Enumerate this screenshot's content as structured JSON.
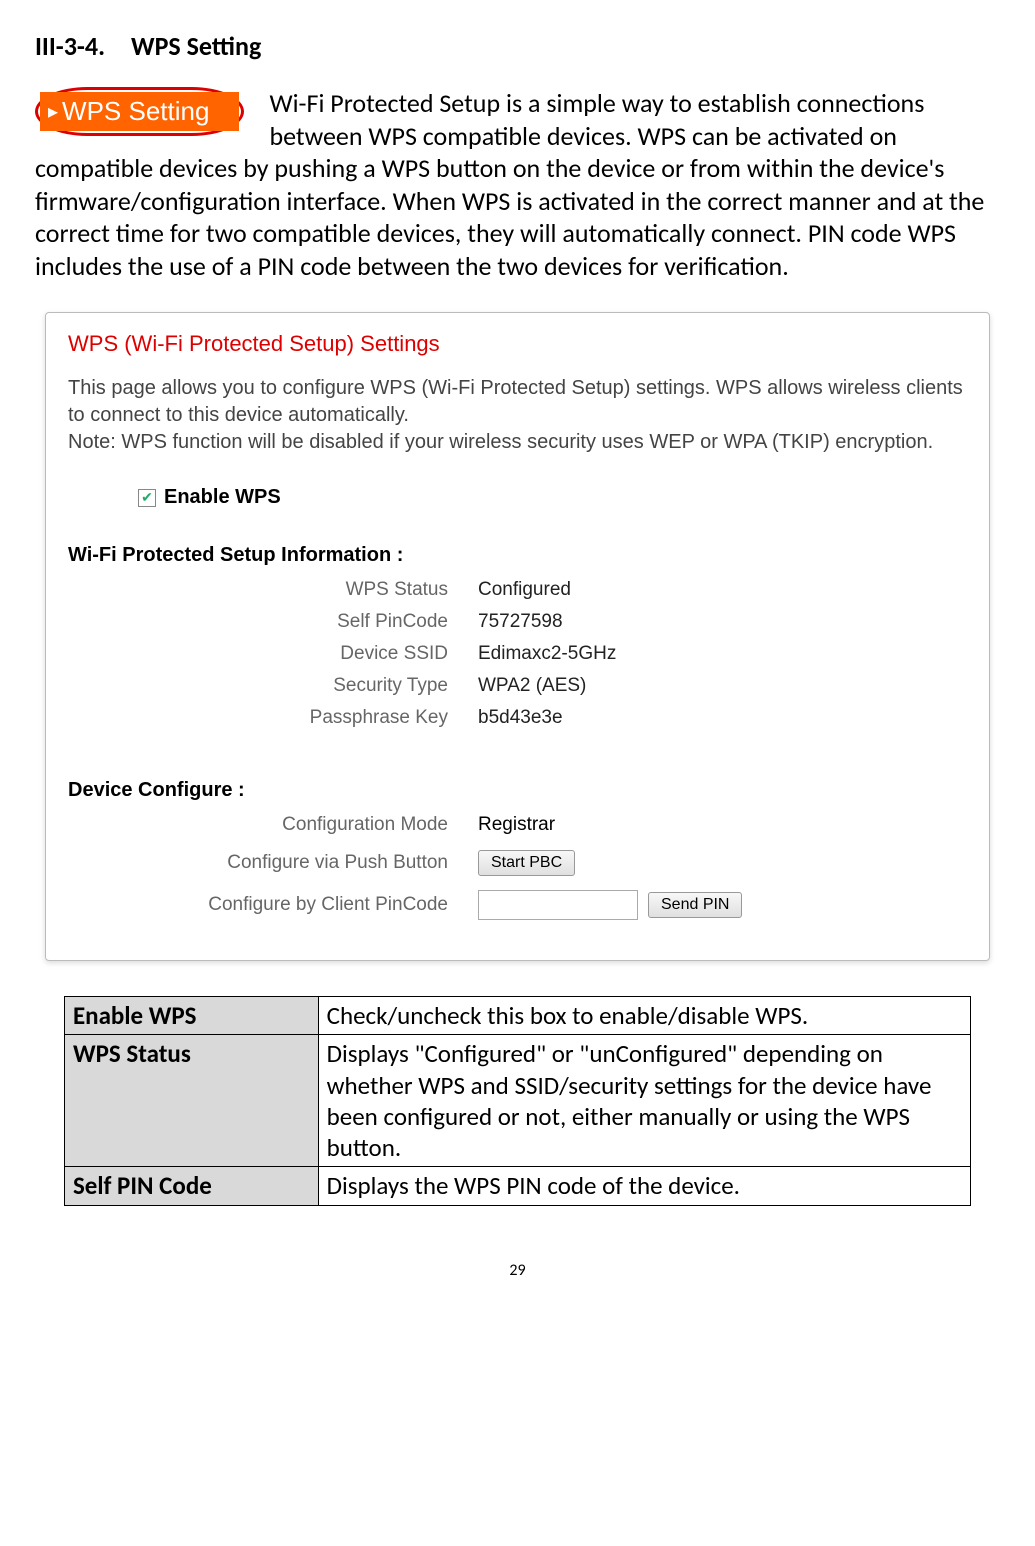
{
  "heading": "III-3-4. WPS Setting",
  "badge_text": "WPS Setting",
  "intro_text": "Wi-Fi Protected Setup is a simple way to establish connections between WPS compatible devices. WPS can be activated on compatible devices by pushing a WPS button on the device or from within the device's firmware/configuration interface. When WPS is activated in the correct manner and at the correct time for two compatible devices, they will automatically connect. PIN code WPS includes the use of a PIN code between the two devices for verification.",
  "panel": {
    "title": "WPS (Wi-Fi Protected Setup) Settings",
    "desc_line1": "This page allows you to configure WPS (Wi-Fi Protected Setup) settings. WPS allows wireless clients to connect to this device automatically.",
    "desc_line2": "Note: WPS function will be disabled if your wireless security uses WEP or WPA (TKIP) encryption.",
    "enable_label": "Enable WPS",
    "info_title": "Wi-Fi Protected Setup Information  :",
    "info": {
      "wps_status_label": "WPS Status",
      "wps_status_value": "Configured",
      "self_pin_label": "Self PinCode",
      "self_pin_value": "75727598",
      "ssid_label": "Device SSID",
      "ssid_value": "Edimaxc2-5GHz",
      "security_label": "Security Type",
      "security_value": "WPA2 (AES)",
      "passphrase_label": "Passphrase Key",
      "passphrase_value": "b5d43e3e"
    },
    "config_title": "Device Configure  :",
    "config": {
      "mode_label": "Configuration Mode",
      "mode_value": "Registrar",
      "pbc_label": "Configure via Push Button",
      "pbc_button": "Start PBC",
      "pin_label": "Configure by Client PinCode",
      "send_pin_button": "Send PIN"
    }
  },
  "table": {
    "r1_term": "Enable WPS",
    "r1_desc": "Check/uncheck this box to enable/disable WPS.",
    "r2_term": "WPS Status",
    "r2_desc": "Displays \"Configured\" or \"unConfigured\" depending on whether WPS and SSID/security settings for the device have been configured or not, either manually or using the WPS button.",
    "r3_term": "Self PIN Code",
    "r3_desc": "Displays the WPS PIN code of the device."
  },
  "page_number": "29"
}
